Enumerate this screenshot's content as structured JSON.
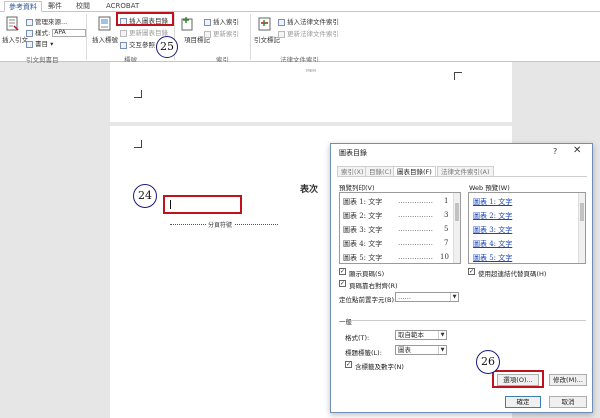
{
  "ribbon": {
    "tabs": [
      "參考資料",
      "郵件",
      "校閱",
      "ACROBAT"
    ],
    "citations": {
      "insert_citation": "插入引文",
      "manage_sources": "管理來源...",
      "style_label": "樣式:",
      "style_value": "APA",
      "bibliography": "書目",
      "group": "引文與書目"
    },
    "captions": {
      "insert_caption": "插入標號",
      "insert_table_of_figures": "插入圖表目錄",
      "update_table": "更新圖表目錄",
      "cross_reference": "交互參照",
      "group": "標號"
    },
    "index": {
      "mark_entry": "項目標記",
      "insert_index": "插入索引",
      "update_index": "更新索引",
      "group": "索引"
    },
    "authorities": {
      "mark_citation": "引文標記",
      "insert_table_of_authorities": "插入法律文件索引",
      "update_table": "更新法律文件索引",
      "group": "法律文件索引"
    }
  },
  "document": {
    "heading": "表次",
    "section_break": "分頁符號",
    "header_mark": "ᴍᴇᴍ"
  },
  "annotations": {
    "step24": "24",
    "step25": "25",
    "step26": "26"
  },
  "dialog": {
    "title": "圖表目錄",
    "help": "?",
    "close": "✕",
    "tabs": [
      "索引(X)",
      "目錄(C)",
      "圖表目錄(F)",
      "法律文件索引(A)"
    ],
    "print_preview_label": "預覽列印(V)",
    "web_preview_label": "Web 預覽(W)",
    "print_rows": [
      {
        "text": "圖表 1: 文字",
        "num": "1"
      },
      {
        "text": "圖表 2: 文字",
        "num": "3"
      },
      {
        "text": "圖表 3: 文字",
        "num": "5"
      },
      {
        "text": "圖表 4: 文字",
        "num": "7"
      },
      {
        "text": "圖表 5: 文字",
        "num": "10"
      }
    ],
    "web_rows": [
      "圖表 1: 文字",
      "圖表 2: 文字",
      "圖表 3: 文字",
      "圖表 4: 文字",
      "圖表 5: 文字"
    ],
    "show_page_numbers": "顯示頁碼(S)",
    "right_align": "頁碼靠右對齊(R)",
    "tab_leader_label": "定位點前置字元(B):",
    "tab_leader_value": "……",
    "use_hyperlinks": "使用超連結代替頁碼(H)",
    "general_label": "一般",
    "formats_label": "格式(T):",
    "formats_value": "取自範本",
    "caption_label": "標題標籤(L):",
    "caption_value": "圖表",
    "include_label": "含標籤及數字(N)",
    "options_button": "選項(O)...",
    "modify_button": "修改(M)...",
    "ok_button": "確定",
    "cancel_button": "取消"
  }
}
